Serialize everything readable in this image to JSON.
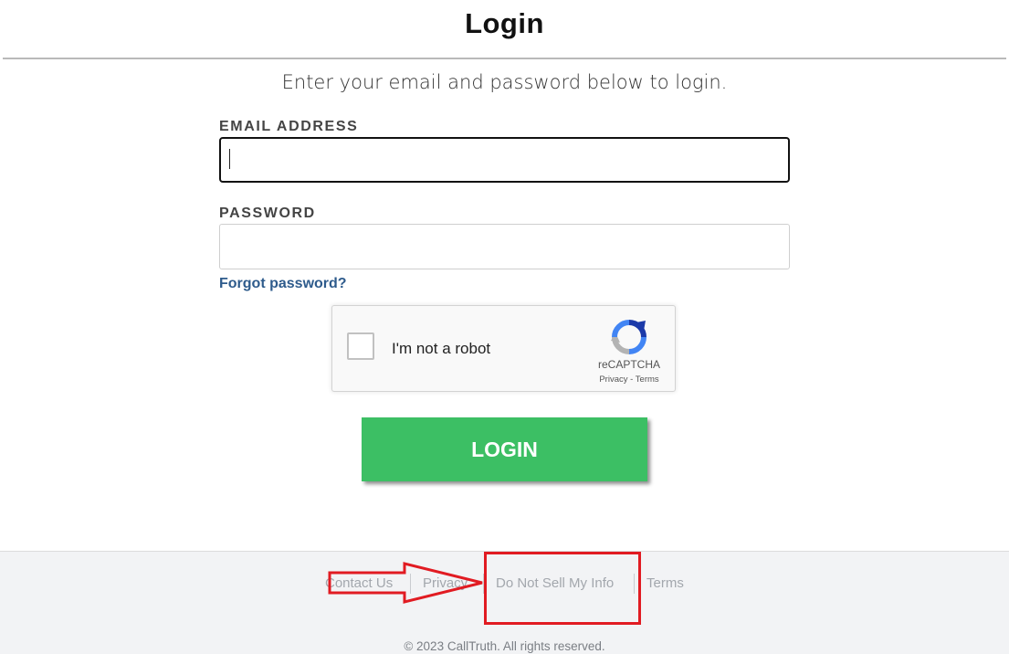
{
  "page": {
    "title": "Login",
    "subtitle": "Enter your email and password below to login."
  },
  "form": {
    "email_label": "EMAIL ADDRESS",
    "email_value": "",
    "password_label": "PASSWORD",
    "password_value": "",
    "forgot_label": "Forgot password?",
    "login_label": "LOGIN"
  },
  "recaptcha": {
    "label": "I'm not a robot",
    "brand": "reCAPTCHA",
    "privacy": "Privacy",
    "separator": "-",
    "terms": "Terms",
    "checked": false
  },
  "footer": {
    "links": [
      "Contact Us",
      "Privacy",
      "Do Not Sell My Info",
      "Terms"
    ],
    "copyright": "© 2023 CallTruth. All rights reserved."
  },
  "colors": {
    "login_button": "#3cbf64",
    "link": "#2e5b8c",
    "annotation": "#e11b22",
    "footer_bg": "#f2f3f5"
  },
  "icons": [
    "recaptcha-logo-icon",
    "annotation-arrow-icon"
  ]
}
